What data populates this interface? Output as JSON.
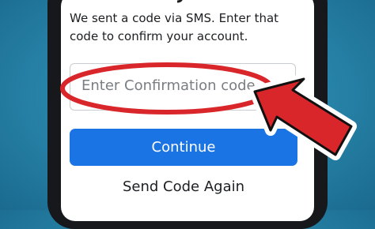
{
  "screen": {
    "description": "We sent a code via SMS. Enter that code to confirm your account.",
    "input": {
      "placeholder": "Enter Confirmation code"
    },
    "continue_label": "Continue",
    "send_again_label": "Send Code Again"
  },
  "colors": {
    "background": "#2a87ad",
    "button": "#1b74e4",
    "highlight": "#d9262b"
  },
  "icons": [
    "red-circle-highlight",
    "red-arrow-icon"
  ]
}
